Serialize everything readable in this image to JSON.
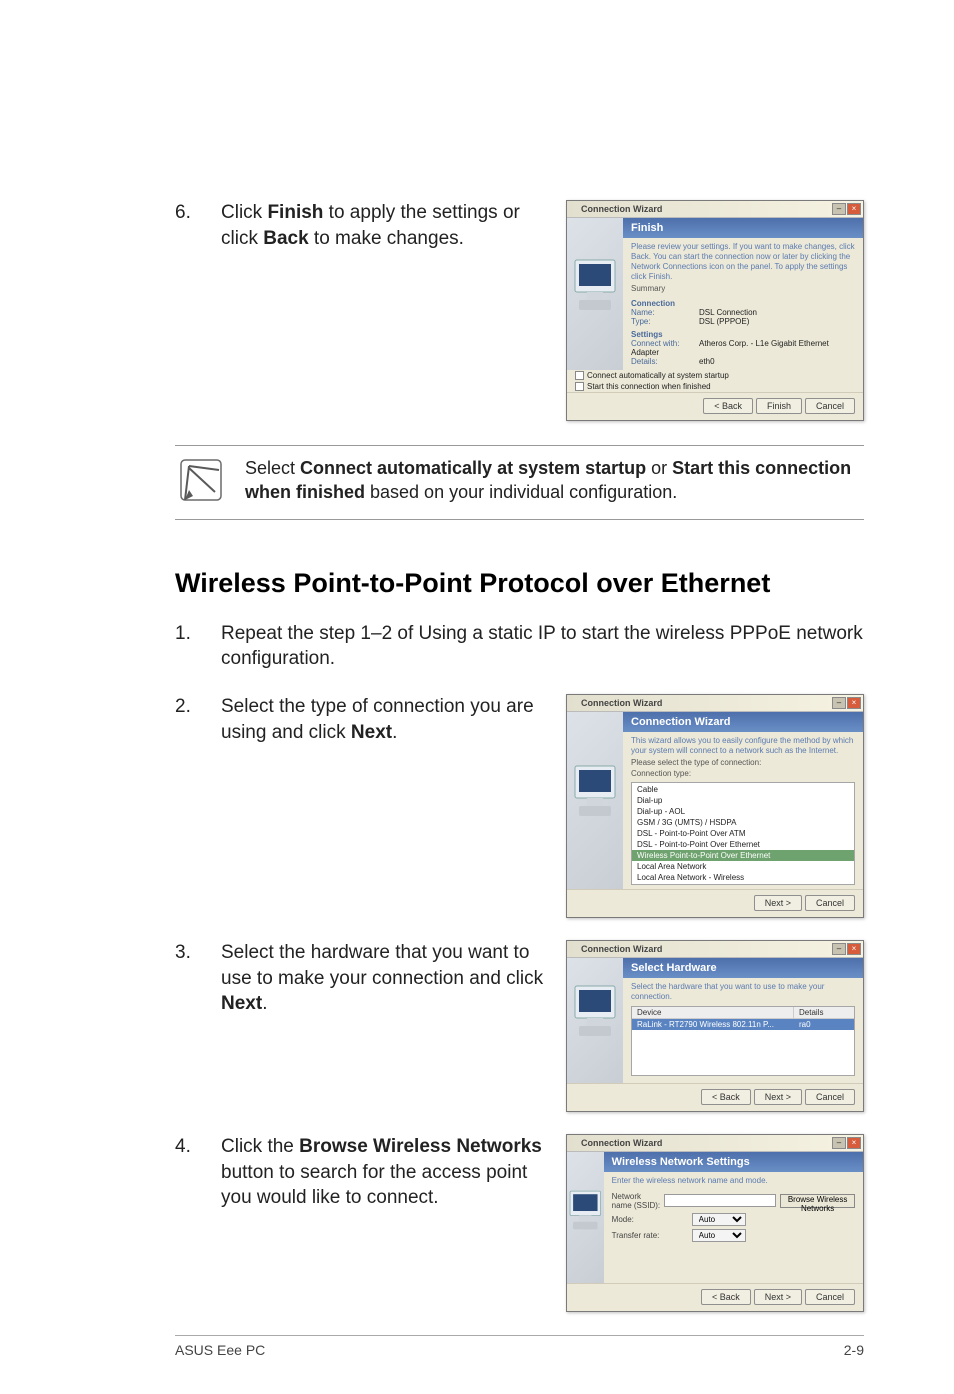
{
  "list_num_6": "6.",
  "step6_text_a": "Click ",
  "step6_text_b": " to apply the settings or click ",
  "step6_text_c": " to make changes.",
  "bold_finish": "Finish",
  "bold_back": "Back",
  "note_a": "Select ",
  "note_b": " or ",
  "note_c": " based on your individual configuration.",
  "note_bold1": "Connect automatically at system startup",
  "note_bold2": "Start this connection when finished",
  "heading": "Wireless Point-to-Point Protocol over Ethernet",
  "list_num_1": "1.",
  "step1_text": "Repeat the step 1–2 of Using a static IP to start the wireless PPPoE network configuration.",
  "list_num_2": "2.",
  "step2_text_a": "Select the type of connection you are using and click ",
  "step2_text_b": ".",
  "bold_next": "Next",
  "list_num_3": "3.",
  "step3_text_a": "Select the hardware that you want to use to make your connection and click ",
  "step3_text_b": ".",
  "list_num_4": "4.",
  "step4_text_a": "Click the ",
  "step4_text_b": " button to search for the access point you would like to connect.",
  "bold_browse": "Browse Wireless Networks",
  "footer_left": "ASUS Eee PC",
  "footer_right": "2-9",
  "wizard_title": "Connection Wizard",
  "wiz1": {
    "heading": "Finish",
    "desc": "Please review your settings. If you want to make changes, click Back. You can start the connection now or later by clicking the Network Connections icon on the panel. To apply the settings click Finish.",
    "summary_label": "Summary",
    "sec_connection": "Connection",
    "name_lbl": "Name:",
    "name_val": "DSL Connection",
    "type_lbl": "Type:",
    "type_val": "DSL (PPPOE)",
    "sec_settings": "Settings",
    "cw_lbl": "Connect with:",
    "cw_val": "Atheros Corp. - L1e Gigabit Ethernet Adapter",
    "det_lbl": "Details:",
    "det_val": "eth0",
    "chk1": "Connect automatically at system startup",
    "chk2": "Start this connection when finished",
    "btn_back": "< Back",
    "btn_finish": "Finish",
    "btn_cancel": "Cancel"
  },
  "wiz2": {
    "heading": "Connection Wizard",
    "desc": "This wizard allows you to easily configure the method by which your system will connect to a network such as the Internet.",
    "sub": "Please select the type of connection:",
    "label": "Connection type:",
    "items": [
      "Cable",
      "Dial-up",
      "Dial-up - AOL",
      "GSM / 3G (UMTS) / HSDPA",
      "DSL - Point-to-Point Over ATM",
      "DSL - Point-to-Point Over Ethernet",
      "Wireless Point-to-Point Over Ethernet",
      "Local Area Network",
      "Local Area Network - Wireless"
    ],
    "selected_index": 6,
    "btn_next": "Next >",
    "btn_cancel": "Cancel"
  },
  "wiz3": {
    "heading": "Select Hardware",
    "desc": "Select the hardware that you want to use to make your connection.",
    "th_device": "Device",
    "th_details": "Details",
    "row_device": "RaLink - RT2790 Wireless 802.11n P...",
    "row_details": "ra0",
    "btn_back": "< Back",
    "btn_next": "Next >",
    "btn_cancel": "Cancel"
  },
  "wiz4": {
    "heading": "Wireless Network Settings",
    "desc": "Enter the wireless network name and mode.",
    "ssid_lbl": "Network name (SSID):",
    "mode_lbl": "Mode:",
    "rate_lbl": "Transfer rate:",
    "mode_val": "Auto",
    "rate_val": "Auto",
    "browse_btn": "Browse Wireless Networks",
    "btn_back": "< Back",
    "btn_next": "Next >",
    "btn_cancel": "Cancel"
  }
}
